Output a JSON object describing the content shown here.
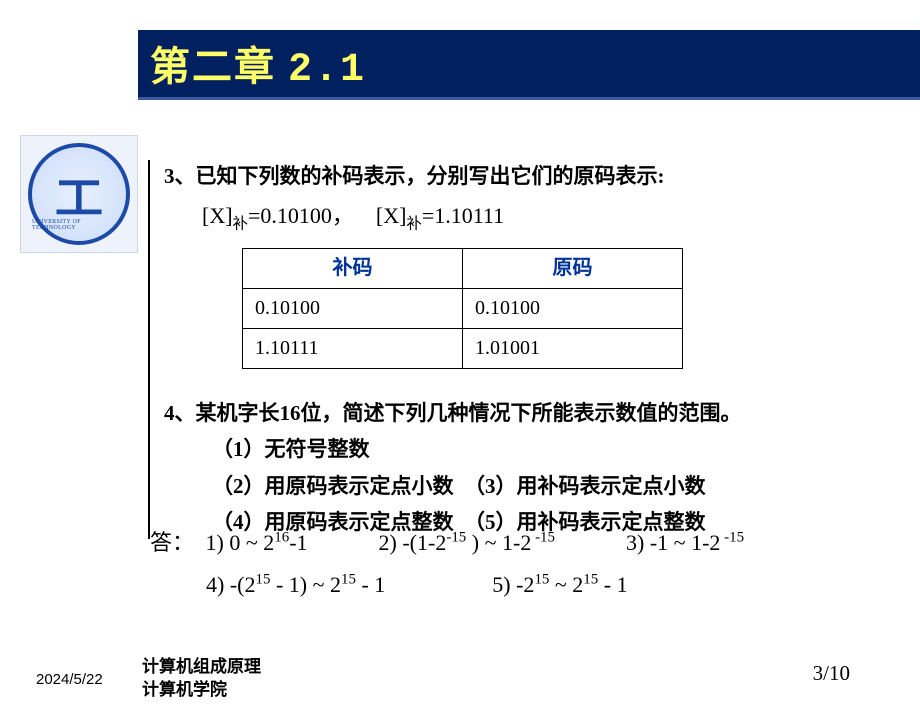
{
  "title": {
    "chapter": "第二章",
    "section": "2.1"
  },
  "logo": {
    "glyph": "工",
    "ring_text": "UNIVERSITY OF TECHNOLOGY"
  },
  "q3": {
    "number": "3",
    "sep": "、",
    "text": "已知下列数的补码表示，分别写出它们的原码表示:",
    "given_a": "[X]",
    "given_a_sub": "补",
    "given_a_eq": "=0.10100，",
    "given_b": "[X]",
    "given_b_sub": "补",
    "given_b_eq": "=1.10111",
    "table": {
      "h1": "补码",
      "h2": "原码",
      "r1c1": "0.10100",
      "r1c2": "0.10100",
      "r2c1": "1.10111",
      "r2c2": "1.01001"
    }
  },
  "q4": {
    "number": "4",
    "sep": "、",
    "text": "某机字长16位，简述下列几种情况下所能表示数值的范围。",
    "i1": "（1）无符号整数",
    "i2": "（2）用原码表示定点小数",
    "i3": "（3）用补码表示定点小数",
    "i4": "（4）用原码表示定点整数",
    "i5": "（5）用补码表示定点整数"
  },
  "answer": {
    "label": "答：",
    "a1_pre": "1) 0 ~ 2",
    "a1_exp": "16",
    "a1_post": "-1",
    "a2_pre": "2) -(1-2",
    "a2_e1": "-15",
    "a2_mid": " ) ~ 1-2",
    "a2_e2": " -15",
    "a3_pre": "3) -1 ~ 1-2",
    "a3_e1": " -15",
    "a4_pre": "4) -(2",
    "a4_e1": "15",
    "a4_mid": " - 1) ~ 2",
    "a4_e2": "15",
    "a4_post": " - 1",
    "a5_pre": "5) -2",
    "a5_e1": "15",
    "a5_mid": "  ~ 2",
    "a5_e2": "15",
    "a5_post": " - 1"
  },
  "footer": {
    "date": "2024/5/22",
    "course": "计算机组成原理",
    "dept": "计算机学院",
    "page": "3/10"
  }
}
